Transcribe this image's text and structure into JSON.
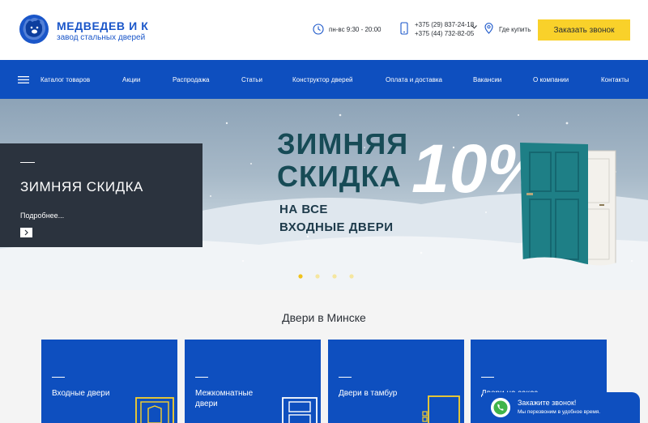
{
  "header": {
    "brand": "МЕДВЕДЕВ И К",
    "tagline": "завод стальных дверей",
    "hours": "пн-вс 9:30 - 20:00",
    "phones": [
      "+375 (29) 837-24-18",
      "+375 (44) 732-82-05"
    ],
    "where_to_buy": "Где купить",
    "call_button": "Заказать звонок"
  },
  "nav": {
    "items": [
      "Каталог товаров",
      "Акции",
      "Распродажа",
      "Статьи",
      "Конструктор дверей",
      "Оплата и доставка",
      "Вакансии",
      "О компании",
      "Контакты"
    ]
  },
  "hero": {
    "box_title": "ЗИМНЯЯ СКИДКА",
    "box_more": "Подробнее...",
    "banner_line1": "ЗИМНЯЯ",
    "banner_line2": "СКИДКА",
    "banner_percent": "10%",
    "banner_line3": "НА ВСЕ",
    "banner_line4": "ВХОДНЫЕ  ДВЕРИ",
    "slides_count": 4,
    "active_slide": 1
  },
  "section": {
    "title": "Двери в Минске",
    "cards": [
      "Входные двери",
      "Межкомнатные двери",
      "Двери в тамбур",
      "Двери на заказ"
    ]
  },
  "widget": {
    "title": "Закажите звонок!",
    "subtitle": "Мы перезвоним в удобное время."
  },
  "colors": {
    "brand_blue": "#0e4fbf",
    "accent_yellow": "#f9d12a",
    "dark_panel": "#2b333e"
  }
}
